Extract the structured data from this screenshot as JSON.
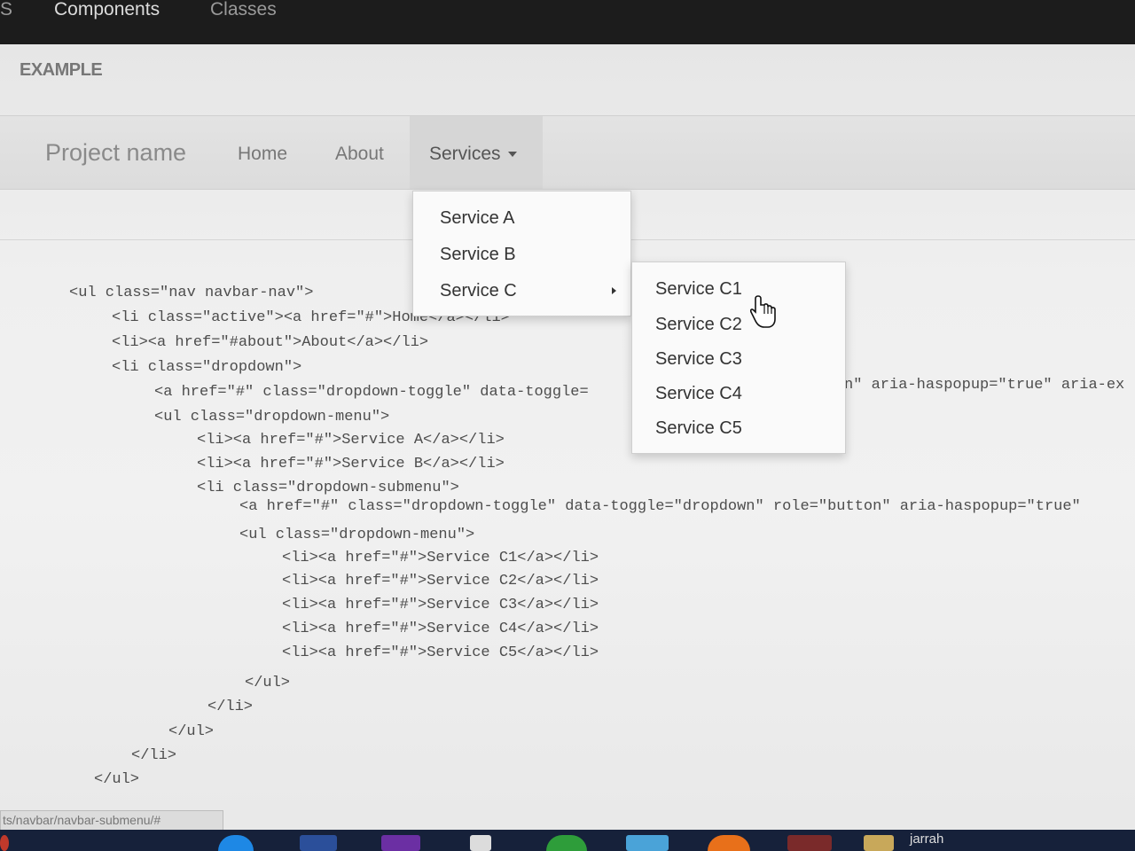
{
  "doc_nav": {
    "items": [
      {
        "label": "S"
      },
      {
        "label": "Components"
      },
      {
        "label": "Classes"
      }
    ]
  },
  "example_label": "EXAMPLE",
  "navbar": {
    "brand": "Project name",
    "links": [
      {
        "label": "Home"
      },
      {
        "label": "About"
      },
      {
        "label": "Services"
      }
    ]
  },
  "dropdown": {
    "items": [
      {
        "label": "Service A"
      },
      {
        "label": "Service B"
      },
      {
        "label": "Service C"
      }
    ]
  },
  "submenu": {
    "items": [
      {
        "label": "Service C1"
      },
      {
        "label": "Service C2"
      },
      {
        "label": "Service C3"
      },
      {
        "label": "Service C4"
      },
      {
        "label": "Service C5"
      }
    ]
  },
  "code_lines": [
    "<ul class=\"nav navbar-nav\">",
    "<li class=\"active\"><a href=\"#\">Home</a></li>",
    "<li><a href=\"#about\">About</a></li>",
    "<li class=\"dropdown\">",
    "<a href=\"#\" class=\"dropdown-toggle\" data-toggle=",
    "n\" aria-haspopup=\"true\" aria-ex",
    "<ul class=\"dropdown-menu\">",
    "<li><a href=\"#\">Service A</a></li>",
    "<li><a href=\"#\">Service B</a></li>",
    "<li class=\"dropdown-submenu\">",
    "<a href=\"#\" class=\"dropdown-toggle\" data-toggle=\"dropdown\" role=\"button\" aria-haspopup=\"true\"",
    "<ul class=\"dropdown-menu\">",
    "<li><a href=\"#\">Service C1</a></li>",
    "<li><a href=\"#\">Service C2</a></li>",
    "<li><a href=\"#\">Service C3</a></li>",
    "<li><a href=\"#\">Service C4</a></li>",
    "<li><a href=\"#\">Service C5</a></li>",
    "</ul>",
    "</li>",
    "</ul>",
    "</li>",
    "</ul>"
  ],
  "status_url": "ts/navbar/navbar-submenu/#",
  "taskbar": {
    "user_label": "jarrah"
  }
}
